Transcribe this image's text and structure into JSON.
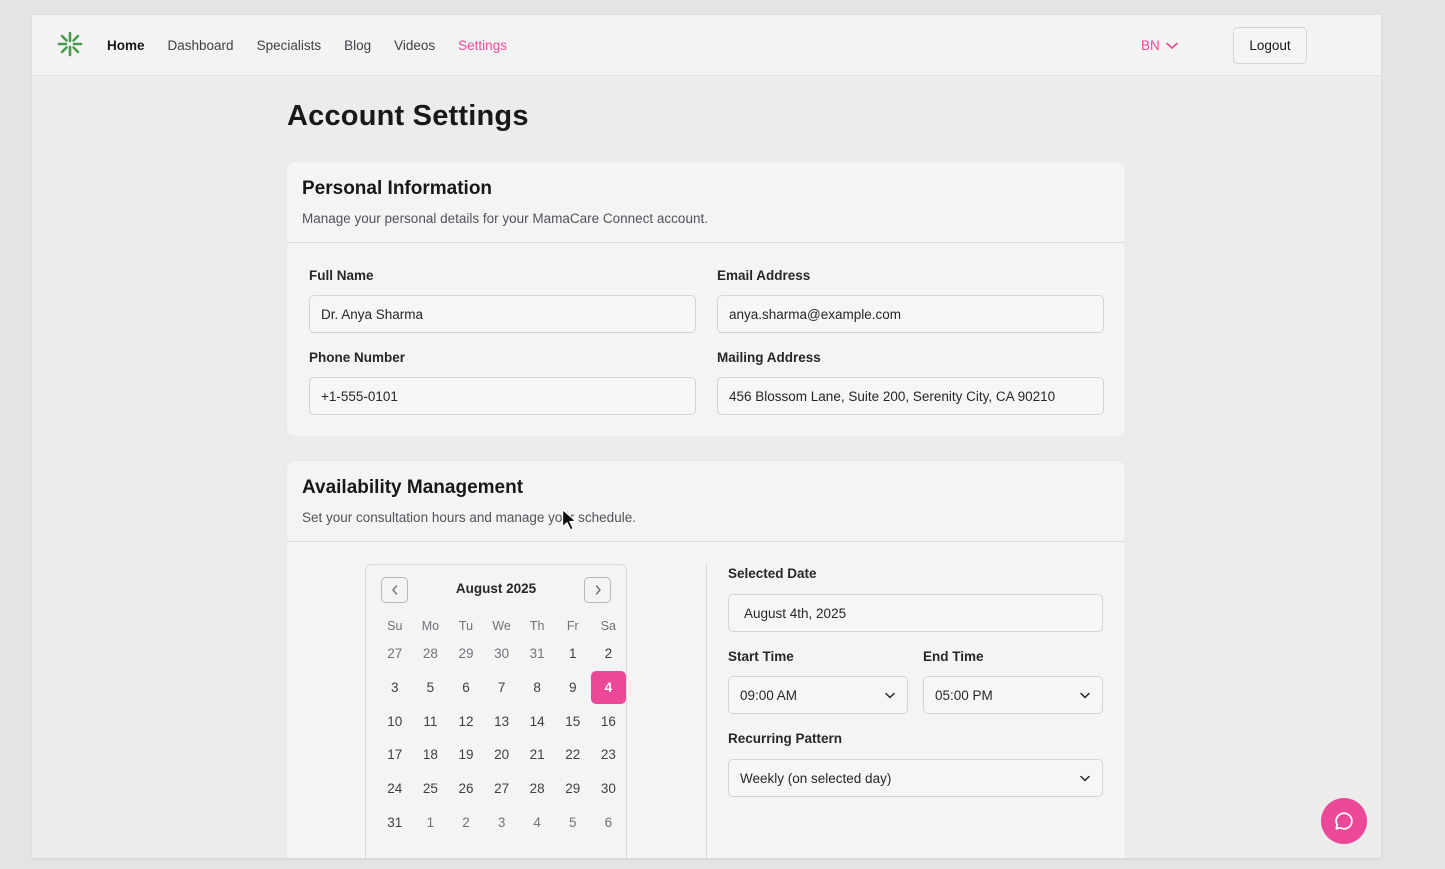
{
  "nav": {
    "items": [
      {
        "label": "Home",
        "cls": "home"
      },
      {
        "label": "Dashboard",
        "cls": ""
      },
      {
        "label": "Specialists",
        "cls": ""
      },
      {
        "label": "Blog",
        "cls": ""
      },
      {
        "label": "Videos",
        "cls": ""
      },
      {
        "label": "Settings",
        "cls": "active"
      }
    ],
    "language": "BN",
    "logout": "Logout"
  },
  "page": {
    "title": "Account Settings"
  },
  "personal": {
    "title": "Personal Information",
    "subtitle": "Manage your personal details for your MamaCare Connect account.",
    "full_name_label": "Full Name",
    "full_name_value": "Dr. Anya Sharma",
    "email_label": "Email Address",
    "email_value": "anya.sharma@example.com",
    "phone_label": "Phone Number",
    "phone_value": "+1-555-0101",
    "address_label": "Mailing Address",
    "address_value": "456 Blossom Lane, Suite 200, Serenity City, CA 90210"
  },
  "availability": {
    "title": "Availability Management",
    "subtitle": "Set your consultation hours and manage your schedule.",
    "calendar": {
      "month": "August 2025",
      "weekdays": [
        "Su",
        "Mo",
        "Tu",
        "We",
        "Th",
        "Fr",
        "Sa"
      ],
      "weeks": [
        [
          "27",
          "28",
          "29",
          "30",
          "31",
          "1",
          "2"
        ],
        [
          "3",
          "5",
          "6",
          "7",
          "8",
          "9",
          "4"
        ],
        [
          "10",
          "11",
          "12",
          "13",
          "14",
          "15",
          "16"
        ],
        [
          "17",
          "18",
          "19",
          "20",
          "21",
          "22",
          "23"
        ],
        [
          "24",
          "25",
          "26",
          "27",
          "28",
          "29",
          "30"
        ],
        [
          "31",
          "1",
          "2",
          "3",
          "4",
          "5",
          "6"
        ]
      ],
      "selected_day": "4"
    },
    "selected_date_label": "Selected Date",
    "selected_date_value": "August 4th, 2025",
    "start_time_label": "Start Time",
    "start_time_value": "09:00 AM",
    "end_time_label": "End Time",
    "end_time_value": "05:00 PM",
    "recurring_label": "Recurring Pattern",
    "recurring_value": "Weekly (on selected day)"
  },
  "colors": {
    "accent": "#ec4899",
    "brand_green": "#4a9a4e"
  }
}
